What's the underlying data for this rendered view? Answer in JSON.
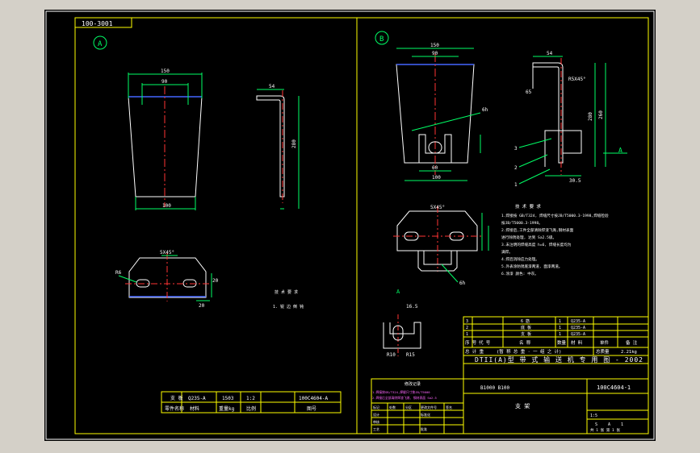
{
  "drawing_number_box": "100-3001",
  "views": {
    "a": {
      "label": "A",
      "dim_top_outer": "150",
      "dim_top_inner": "90",
      "dim_bottom": "100",
      "dim_side_width": "54",
      "dim_side_height": "280",
      "bottom_view_chamfer": "5X45°",
      "bottom_dim_left": "R6",
      "bottom_dim_right_1": "20",
      "bottom_dim_right_2": "20",
      "note_heading": "技 术 要 求",
      "note_line": "1. 锐 边 倒 钝"
    },
    "b": {
      "label": "B",
      "dim_top_outer": "150",
      "dim_top_inner": "90",
      "dim_bottom": "100",
      "dim_slot_width": "60",
      "dim_side_width": "54",
      "dim_side_small": "65",
      "dim_side_height": "280",
      "dim_side_overall": "260",
      "dim_side_radius": "R5X45°",
      "dim_side_bottom": "30.5",
      "section_label": "A",
      "balloons": [
        "1",
        "2",
        "3"
      ],
      "bottom_chamfer": "5X45°",
      "weld_1": "6h",
      "weld_2": "6h",
      "detail_label": "A",
      "detail_dims": [
        "16.5",
        "R10",
        "R15"
      ]
    }
  },
  "tech_notes": {
    "heading": "技 术 要 求",
    "lines": [
      "1.焊接按 GB/T324, 焊缝尺寸按JB/T5000.3-1998,焊缝检验",
      "  按JB/T5000.3-1998。",
      "2.焊接后,工件全部清除焊渣飞溅,钢材表面",
      "  进行除锈处理, 达到 Sa2.5级。",
      "3.未注明的焊缝高度 h=6, 焊缝长度均为",
      "  满焊。",
      "4.焊后消除应力处理。",
      "5.外表涂防锈底漆两道, 面漆两道。",
      "6.涂漆 颜色: 中灰。"
    ]
  },
  "left_title_block": {
    "rows": [
      [
        "支 板",
        "Q235-A",
        "1503",
        "1:2",
        "100C4604-A"
      ],
      [
        "零件名称",
        "材料",
        "重量kg",
        "比例",
        "图号"
      ]
    ]
  },
  "title_block": {
    "parts_rows": [
      [
        "3",
        "",
        "6 筋",
        "1",
        "Q235-A",
        "",
        ""
      ],
      [
        "2",
        "",
        "底 板",
        "1",
        "Q235-A",
        "",
        ""
      ],
      [
        "1",
        "",
        "支 板",
        "1",
        "Q235-A",
        "",
        ""
      ]
    ],
    "parts_header": [
      "序 号",
      "代 号",
      "名 称",
      "数量",
      "材 料",
      "单件",
      "备 注"
    ],
    "weight_row": [
      "总 计 重",
      "(暂 称 总 重 · 一 组 之 计)",
      "总质量",
      "2.21kg"
    ],
    "product_title": "DTII(A)型 带 式 输 送 机 专 用 图 - 2002",
    "drawing_code_left": "B1000 B100",
    "drawing_code_right": "100C4604-1",
    "part_name": "支 架",
    "approval_rows": [
      [
        "标记",
        "处数",
        "分区",
        "更改文件号",
        "签名",
        "年月日"
      ],
      [
        "设计",
        "",
        "",
        "标准化",
        "",
        ""
      ],
      [
        "审核",
        "",
        "",
        "",
        "",
        ""
      ],
      [
        "工艺",
        "",
        "",
        "批准",
        "",
        ""
      ]
    ],
    "change_table_heading": "修改记录",
    "change_lines": [
      "1.焊接按GB/T324,焊缝尺寸按JB/T5000",
      "2.焊接后全部清除焊渣飞溅, 钢材表面 Sa2.5"
    ],
    "scale": "1:5",
    "sheet": "共 1 张 第 1 张",
    "stage_marks": [
      "S",
      "A",
      "1"
    ]
  },
  "colors": {
    "background": "#000000",
    "frame": "#ffff00",
    "outline": "#ffffff",
    "centerline": "#ff3333",
    "dimension": "#00ff66",
    "text": "#ffffff",
    "hidden_line": "#4466ff",
    "balloon": "#00ff66",
    "note_text": "#ff66ff"
  }
}
